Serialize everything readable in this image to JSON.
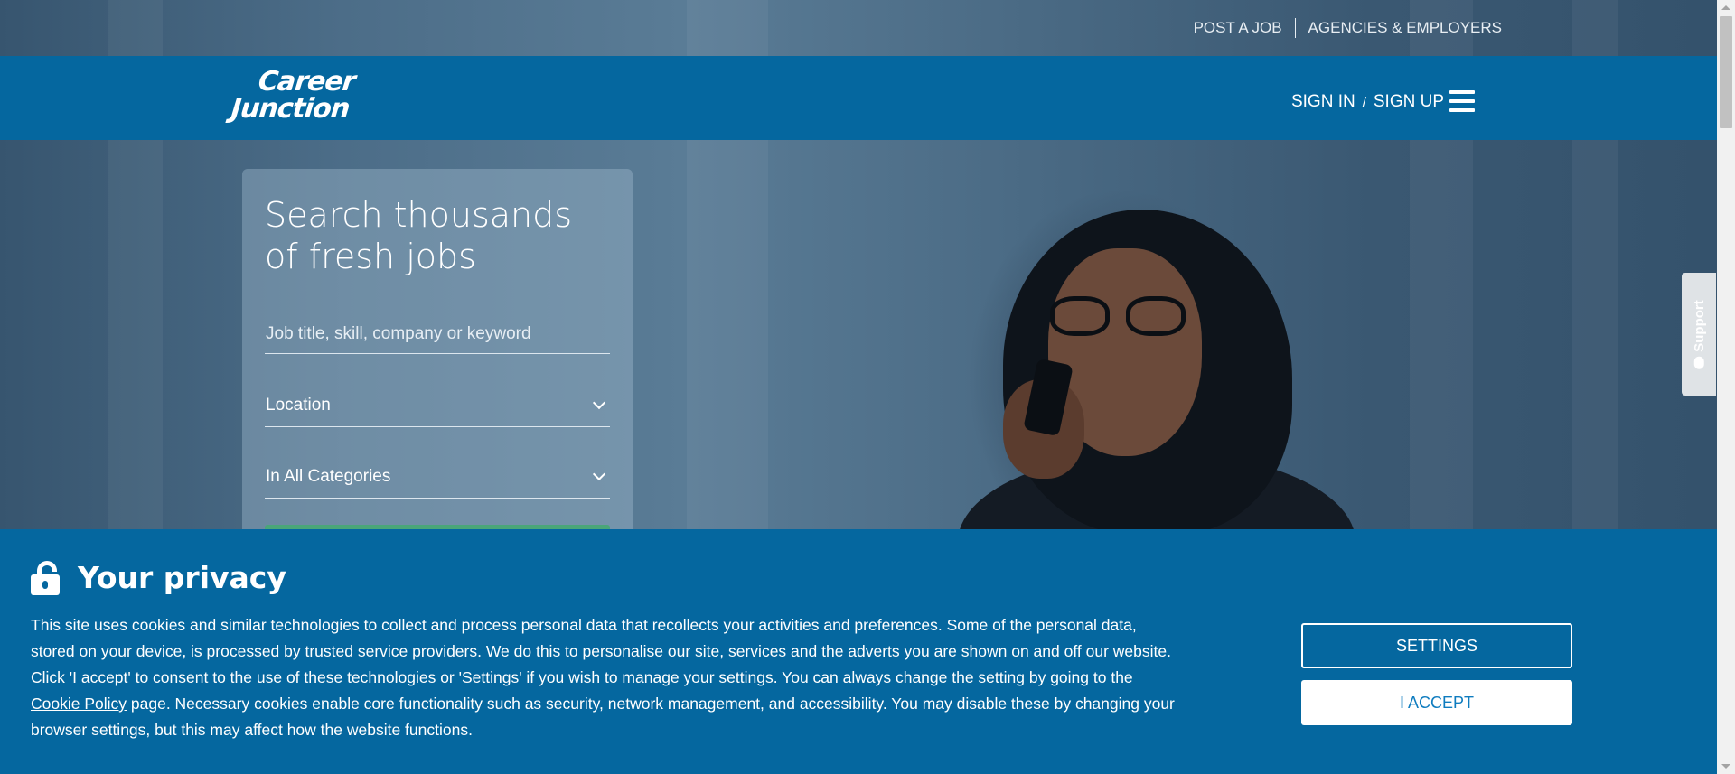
{
  "util_links": {
    "post_job": "POST A JOB",
    "agencies": "AGENCIES & EMPLOYERS"
  },
  "nav": {
    "logo_line1": "Career",
    "logo_line2": "Junction",
    "sign_in": "SIGN IN",
    "slash": "/",
    "sign_up": "SIGN UP"
  },
  "search": {
    "title_line1": "Search thousands",
    "title_line2": "of fresh jobs",
    "keyword_placeholder": "Job title, skill, company or keyword",
    "location": "Location",
    "category": "In All Categories"
  },
  "support": {
    "label": "Support"
  },
  "privacy": {
    "title": "Your privacy",
    "text_part1": "This site uses cookies and similar technologies to collect and process personal data that recollects your activities and preferences. Some of the personal data, stored on your device, is processed by trusted service providers. We do this to personalise our site, services and the adverts you are shown on and off our website. Click 'I accept' to consent to the use of these technologies or 'Settings' if you wish to manage your settings. You can always change the setting by going to the ",
    "cookie_link": "Cookie Policy",
    "text_part2": " page. Necessary cookies enable core functionality such as security, network management, and accessibility. You may disable these by changing your browser settings, but this may affect how the website functions.",
    "settings_button": "SETTINGS",
    "accept_button": "I ACCEPT"
  },
  "colors": {
    "brand_blue": "#05679f",
    "search_button_green": "#4aa679",
    "accept_text": "#0f7cbf"
  },
  "icons": {
    "menu": "hamburger-menu-icon",
    "lock": "unlocked-padlock-icon",
    "dropdown": "chevron-down-icon",
    "support": "chat-bubble-icon"
  }
}
